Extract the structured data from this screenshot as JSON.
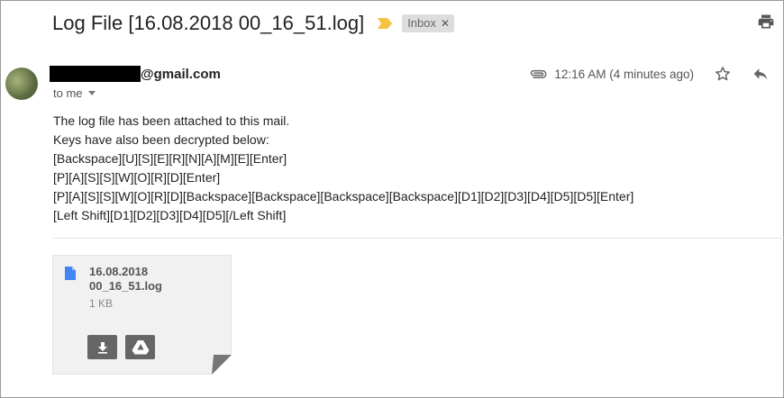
{
  "email": {
    "subject": "Log File [16.08.2018 00_16_51.log]",
    "label": "Inbox",
    "sender_domain": "@gmail.com",
    "recipient": "to me",
    "time": "12:16 AM (4 minutes ago)",
    "body_lines": [
      "The log file has been attached to this mail.",
      "Keys have also been decrypted below:",
      "[Backspace][U][S][E][R][N][A][M][E][Enter]",
      "[P][A][S][S][W][O][R][D][Enter]",
      "[P][A][S][S][W][O][R][D][Backspace][Backspace][Backspace][Backspace][D1][D2][D3][D4][D5][D5][Enter]",
      "[Left Shift][D1][D2][D3][D4][D5][/Left Shift]"
    ]
  },
  "attachment": {
    "name_line1": "16.08.2018",
    "name_line2": "00_16_51.log",
    "size": "1 KB"
  },
  "icons": {
    "importance": "importance-marker-icon",
    "label_remove": "close-icon",
    "print": "print-icon",
    "attachment_clip": "paperclip-icon",
    "star": "star-icon",
    "reply": "reply-icon",
    "file": "file-icon",
    "download": "download-icon",
    "drive": "drive-icon"
  },
  "colors": {
    "importance": "#f5c242",
    "file_icon": "#4285f4",
    "button": "#666666",
    "chip_bg": "#dddddd"
  }
}
